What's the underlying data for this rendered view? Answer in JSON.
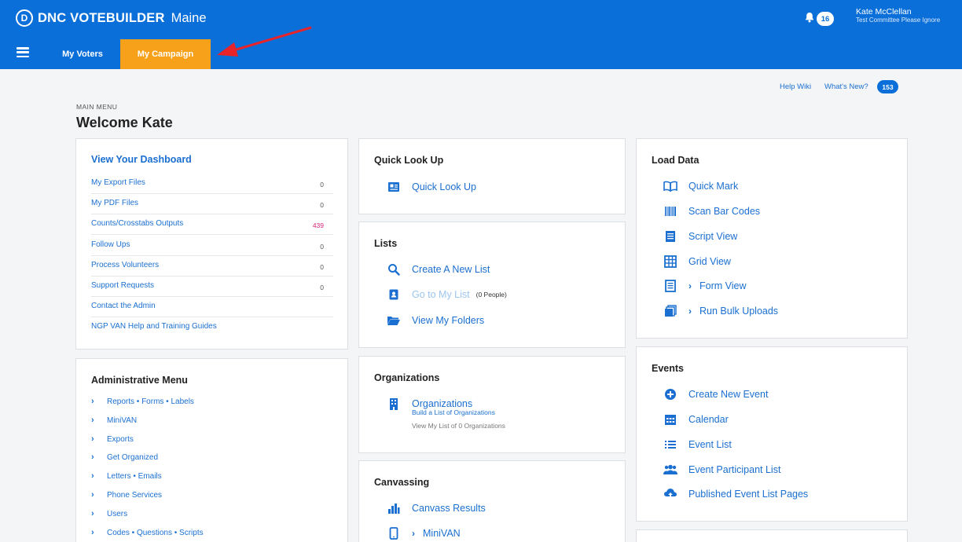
{
  "header": {
    "brand_name": "DNC VOTEBUILDER",
    "brand_logo_letter": "D",
    "state": "Maine",
    "notification_count": "16",
    "user_name": "Kate McClellan",
    "user_org": "Test Committee Please Ignore",
    "colors": {
      "primary": "#0a6fd8",
      "active_tab": "#f7a11a"
    }
  },
  "nav": {
    "menu_icon": "hamburger-icon",
    "tabs": [
      {
        "label": "My Voters",
        "active": false
      },
      {
        "label": "My Campaign",
        "active": true
      }
    ]
  },
  "top_links": {
    "help_wiki": "Help Wiki",
    "whats_new": "What's New?",
    "whats_new_count": "153"
  },
  "page": {
    "section_label": "MAIN MENU",
    "title": "Welcome Kate"
  },
  "dashboard": {
    "title": "View Your Dashboard",
    "items": [
      {
        "label": "My Export Files",
        "count": "0"
      },
      {
        "label": "My PDF Files",
        "count": "0"
      },
      {
        "label": "Counts/Crosstabs Outputs",
        "count": "439"
      },
      {
        "label": "Follow Ups",
        "count": "0"
      },
      {
        "label": "Process Volunteers",
        "count": "0"
      },
      {
        "label": "Support Requests",
        "count": "0"
      },
      {
        "label": "Contact the Admin",
        "count": ""
      },
      {
        "label": "NGP VAN Help and Training Guides",
        "count": ""
      }
    ]
  },
  "admin_menu": {
    "title": "Administrative Menu",
    "items": [
      "Reports • Forms • Labels",
      "MiniVAN",
      "Exports",
      "Get Organized",
      "Letters • Emails",
      "Phone Services",
      "Users",
      "Codes • Questions • Scripts"
    ]
  },
  "quick_look_up": {
    "title": "Quick Look Up",
    "action": "Quick Look Up",
    "icon": "id-card-icon"
  },
  "lists": {
    "title": "Lists",
    "create": "Create A New List",
    "go_to": "Go to My List",
    "go_to_count": "(0 People)",
    "folders": "View My Folders"
  },
  "organizations": {
    "title": "Organizations",
    "action": "Organizations",
    "sub1": "Build a List of Organizations",
    "sub2": "View My List of 0 Organizations"
  },
  "canvassing": {
    "title": "Canvassing",
    "results": "Canvass Results",
    "minivan": "MiniVAN"
  },
  "load_data": {
    "title": "Load Data",
    "items": [
      {
        "label": "Quick Mark",
        "icon": "book-icon"
      },
      {
        "label": "Scan Bar Codes",
        "icon": "barcode-icon"
      },
      {
        "label": "Script View",
        "icon": "document-icon"
      },
      {
        "label": "Grid View",
        "icon": "grid-icon"
      },
      {
        "label": "Form View",
        "icon": "form-icon"
      },
      {
        "label": "Run Bulk Uploads",
        "icon": "stack-icon"
      }
    ]
  },
  "events": {
    "title": "Events",
    "items": [
      {
        "label": "Create New Event",
        "icon": "plus-circle-icon"
      },
      {
        "label": "Calendar",
        "icon": "calendar-icon"
      },
      {
        "label": "Event List",
        "icon": "list-icon"
      },
      {
        "label": "Event Participant List",
        "icon": "people-icon"
      },
      {
        "label": "Published Event List Pages",
        "icon": "cloud-upload-icon"
      }
    ]
  }
}
